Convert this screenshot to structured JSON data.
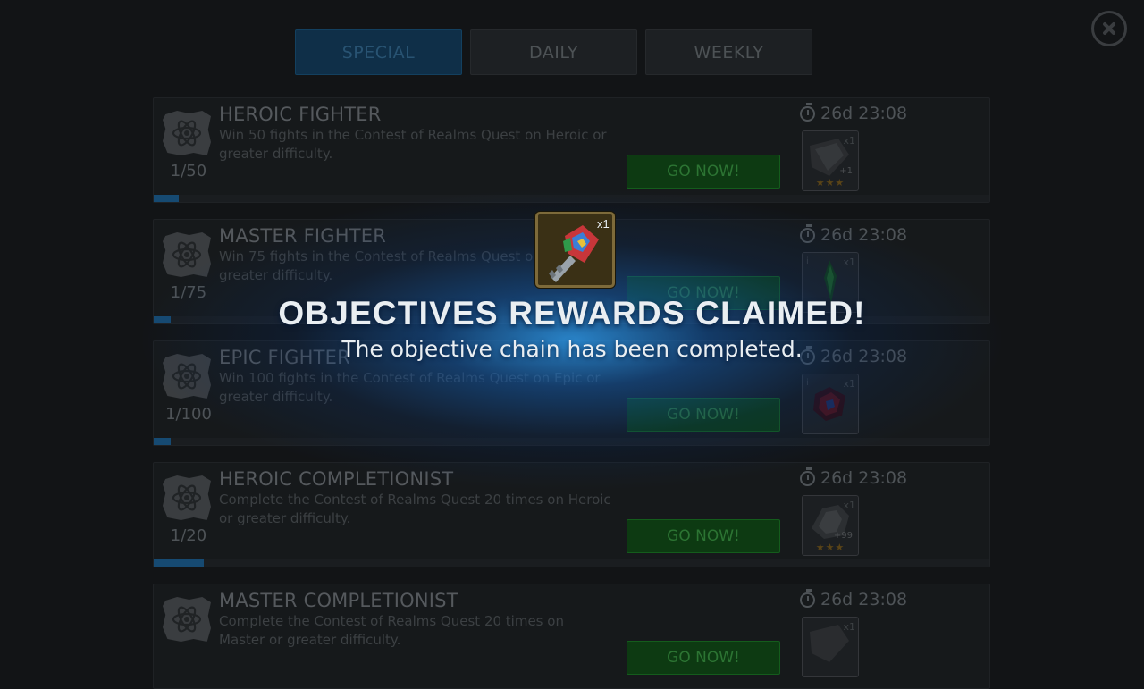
{
  "tabs": [
    {
      "label": "SPECIAL",
      "active": true
    },
    {
      "label": "DAILY",
      "active": false
    },
    {
      "label": "WEEKLY",
      "active": false
    }
  ],
  "objectives": [
    {
      "title": "HEROIC FIGHTER",
      "description": "Win 50 fights in the Contest of Realms Quest on Heroic or greater difficulty.",
      "progress_text": "1/50",
      "progress": 0.02,
      "button": "GO NOW!",
      "timer": "26d 23:08",
      "reward_qty": "x1",
      "reward_extra": "+1",
      "reward_stars": "★★★",
      "reward_icon": "gem-icon"
    },
    {
      "title": "MASTER FIGHTER",
      "description": "Win 75 fights in the Contest of Realms Quest on Master or greater difficulty.",
      "progress_text": "1/75",
      "progress": 0.013,
      "button": "GO NOW!",
      "timer": "26d 23:08",
      "reward_qty": "x1",
      "reward_extra": "",
      "reward_stars": "",
      "reward_icon": "green-crystal-icon"
    },
    {
      "title": "EPIC FIGHTER",
      "description": "Win 100 fights in the Contest of Realms Quest on Epic or greater difficulty.",
      "progress_text": "1/100",
      "progress": 0.01,
      "button": "GO NOW!",
      "timer": "26d 23:08",
      "reward_qty": "x1",
      "reward_extra": "",
      "reward_stars": "",
      "reward_icon": "red-crystal-icon"
    },
    {
      "title": "HEROIC COMPLETIONIST",
      "description": "Complete the Contest of Realms Quest 20 times on Heroic or greater difficulty.",
      "progress_text": "1/20",
      "progress": 0.05,
      "button": "GO NOW!",
      "timer": "26d 23:08",
      "reward_qty": "x1",
      "reward_extra": "+99",
      "reward_stars": "★★★",
      "reward_icon": "shard-icon"
    },
    {
      "title": "MASTER COMPLETIONIST",
      "description": "Complete the Contest of Realms Quest 20 times on Master or greater difficulty.",
      "progress_text": "",
      "progress": 0,
      "button": "GO NOW!",
      "timer": "26d 23:08",
      "reward_qty": "x1",
      "reward_extra": "",
      "reward_stars": "",
      "reward_icon": "gem-icon"
    }
  ],
  "popup": {
    "item_qty": "x1",
    "item_icon": "key-icon",
    "headline": "OBJECTIVES REWARDS CLAIMED!",
    "subline": "The objective chain has been completed."
  }
}
